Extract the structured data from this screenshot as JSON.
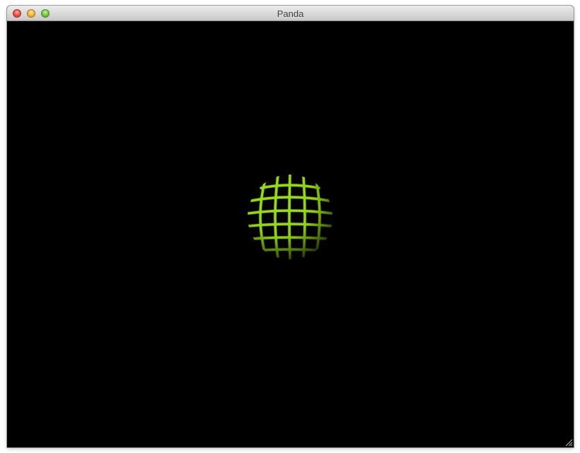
{
  "window": {
    "title": "Panda"
  },
  "scene": {
    "background_color": "#000000",
    "object": "wireframe-sphere",
    "grid_color": "#9bdc1a"
  },
  "icons": {
    "close": "close-button-icon",
    "minimize": "minimize-button-icon",
    "zoom": "zoom-button-icon",
    "resize": "resize-grip-icon"
  }
}
